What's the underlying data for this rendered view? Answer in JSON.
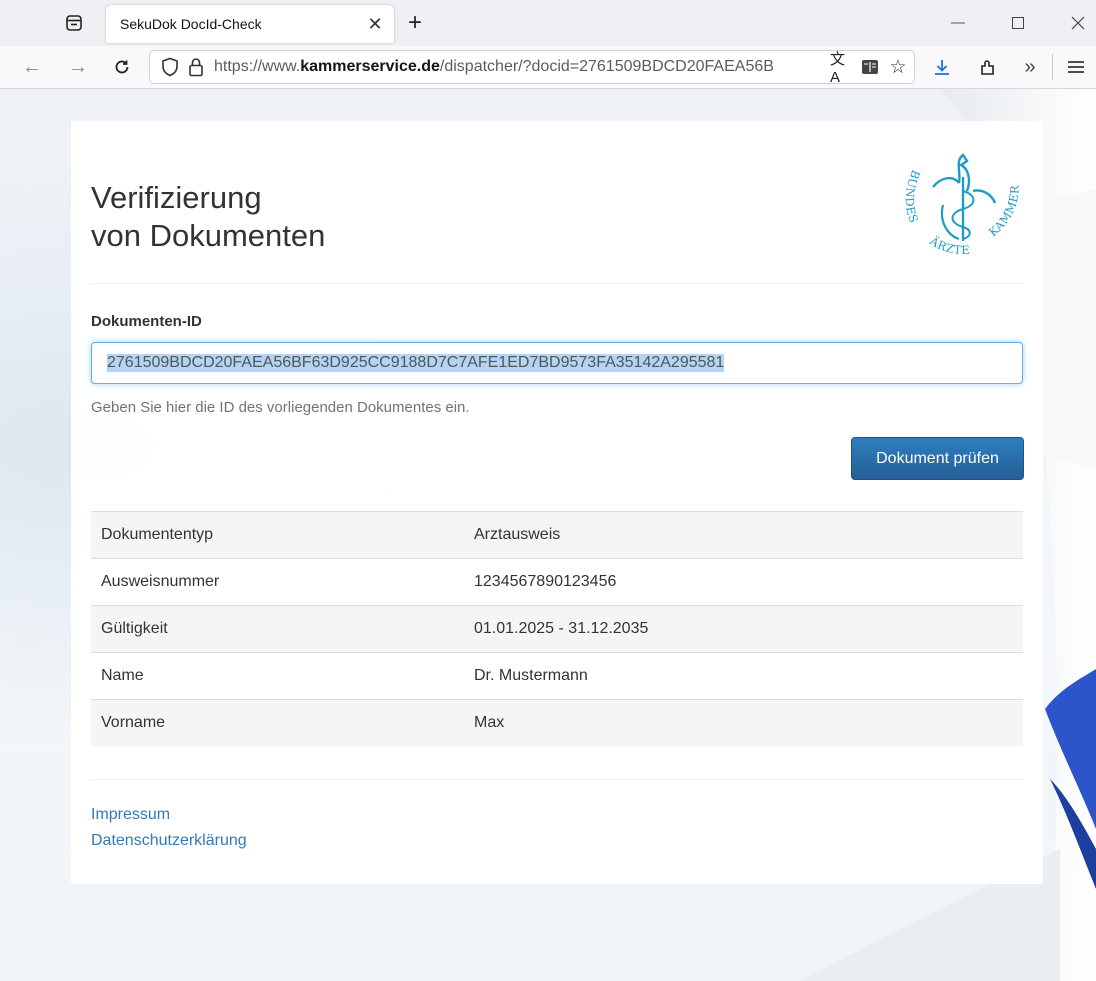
{
  "browser": {
    "tab_title": "SekuDok DocId-Check",
    "url_prefix": "https://www.",
    "url_domain": "kammerservice.de",
    "url_path": "/dispatcher/?docid=2761509BDCD20FAEA56B"
  },
  "page": {
    "title_line1": "Verifizierung",
    "title_line2": "von Dokumenten",
    "logo_text": "BUNDESÄRZTEKAMMER",
    "field_label": "Dokumenten-ID",
    "doc_id": "2761509BDCD20FAEA56BF63D925CC9188D7C7AFE1ED7BD9573FA35142A295581",
    "help_text": "Geben Sie hier die ID des vorliegenden Dokumentes ein.",
    "check_button": "Dokument prüfen"
  },
  "result": [
    {
      "label": "Dokumententyp",
      "value": "Arztausweis"
    },
    {
      "label": "Ausweisnummer",
      "value": "1234567890123456"
    },
    {
      "label": "Gültigkeit",
      "value": "01.01.2025 - 31.12.2035"
    },
    {
      "label": "Name",
      "value": "Dr. Mustermann"
    },
    {
      "label": "Vorname",
      "value": "Max"
    }
  ],
  "footer": {
    "impressum": "Impressum",
    "datenschutz": "Datenschutzerklärung"
  },
  "icons": {
    "tab_list": "tab-list-icon",
    "close": "close-icon",
    "new_tab": "plus-icon",
    "minimize": "minimize-icon",
    "maximize": "maximize-icon",
    "window_close": "window-close-icon",
    "back": "back-arrow-icon",
    "forward": "forward-arrow-icon",
    "reload": "reload-icon",
    "shield": "shield-icon",
    "lock": "lock-icon",
    "translate": "translate-icon",
    "reader": "reader-view-icon",
    "bookmark": "star-icon",
    "download": "download-icon",
    "extensions": "extensions-icon",
    "overflow": "chevron-double-right-icon",
    "menu": "hamburger-menu-icon"
  },
  "colors": {
    "accent": "#337ab7",
    "button": "#2a6ead",
    "logo": "#1f9bc7"
  }
}
